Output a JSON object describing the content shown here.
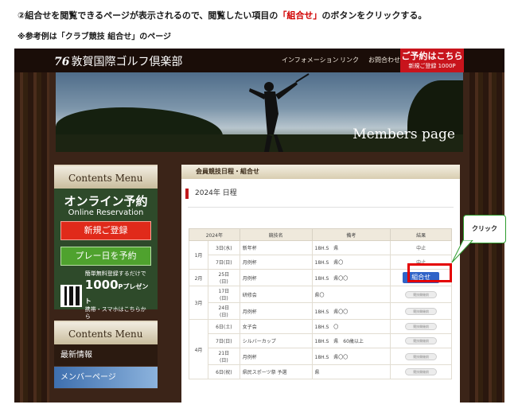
{
  "instruction": {
    "before": "②組合せを閲覧できるページが表示されるので、閲覧したい項目の",
    "highlight": "「組合せ」",
    "after": "のボタンをクリックする。"
  },
  "note": "※参考例は「クラブ競技 組合せ」のページ",
  "site": {
    "logo_mark": "76",
    "logo_text": "敦賀国際ゴルフ倶楽部",
    "nav": [
      "インフォメーション",
      "リンク",
      "お問合わせ"
    ],
    "reserve_line1": "ご予約はこちら",
    "reserve_line2": "新規ご登録 1000P",
    "hero_title": "Members page"
  },
  "sidebar": {
    "menu_title": "Contents Menu",
    "online_title": "オンライン予約",
    "online_sub": "Online Reservation",
    "register_button": "新規ご登録",
    "tee_button": "プレー日を予約",
    "promo_line1": "簡単無料登録するだけで",
    "promo_amount": "1000",
    "promo_unit": "Pプレゼント",
    "promo_line2": "携帯・スマホはこちらから",
    "menu_title2": "Contents Menu",
    "links": [
      "最新情報",
      "メンバーページ"
    ]
  },
  "content": {
    "header": "会員競技日程・組合せ",
    "year_title": "2024年 日程",
    "columns": [
      "2024年",
      "競技名",
      "備考",
      "結果"
    ],
    "rows": [
      {
        "month": "1月",
        "date": "3日(水)",
        "name": "新年杯",
        "note": "18H.S　県",
        "result": "中止",
        "kind": "text"
      },
      {
        "month": "",
        "date": "7日(日)",
        "name": "月例杯",
        "note": "18H.S　県〇",
        "result": "中止",
        "kind": "text"
      },
      {
        "month": "2月",
        "date": "25日\n(日)",
        "name": "月例杯",
        "note": "18H.S　県〇〇",
        "result": "組合せ",
        "kind": "button"
      },
      {
        "month": "3月",
        "date": "17日\n(日)",
        "name": "研修会",
        "note": "県〇",
        "result": "競技開催前",
        "kind": "badge"
      },
      {
        "month": "",
        "date": "24日\n(日)",
        "name": "月例杯",
        "note": "18H.S　県〇〇",
        "result": "競技開催前",
        "kind": "badge"
      },
      {
        "month": "4月",
        "date": "6日(土)",
        "name": "女子会",
        "note": "18H.S　〇",
        "result": "競技開催前",
        "kind": "badge"
      },
      {
        "month": "",
        "date": "7日(日)",
        "name": "シルバーカップ",
        "note": "18H.S　県　60歳以上",
        "result": "競技開催前",
        "kind": "badge"
      },
      {
        "month": "",
        "date": "21日\n(日)",
        "name": "月例杯",
        "note": "18H.S　県〇〇",
        "result": "競技開催前",
        "kind": "badge"
      },
      {
        "month": "",
        "date": "6日(祝)",
        "name": "県民スポーツ祭 予選",
        "note": "県",
        "result": "競技開催前",
        "kind": "badge"
      }
    ]
  },
  "callout": "クリック",
  "colors": {
    "accent_red": "#c0181c",
    "button_blue": "#2f63c8",
    "callout_green": "#2e9c2e"
  }
}
